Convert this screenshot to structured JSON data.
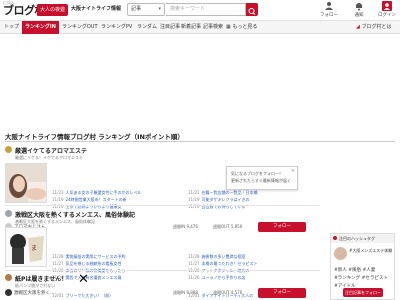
{
  "header": {
    "logo_text": "ブログ村",
    "logo_sub": "にほん",
    "badge": "大人の夜遊",
    "category": "大阪ナイトライフ情報",
    "select_value": "記事",
    "search_placeholder": "検索キーワード",
    "icons": [
      {
        "name": "follow-icon",
        "label": "フォロー"
      },
      {
        "name": "bell-icon",
        "label": "通知"
      },
      {
        "name": "user-icon",
        "label": "ログイン"
      }
    ]
  },
  "nav": {
    "items": [
      "トップ",
      "ランキングIN",
      "ランキングOUT",
      "ランキングPV",
      "ランダム",
      "注目記事",
      "新着記事",
      "記事検索",
      "もっと見る"
    ],
    "active_index": 1,
    "right_link": "ブログ村とは"
  },
  "page_title": "大阪ナイトライフ情報ブログ村 ランキング（INポイント順）",
  "blogs": [
    {
      "title": "厳選イケてるアロマエステ",
      "desc": "厳選にイケる！イケてるアロマエステ",
      "entries_left": [
        {
          "date": "11/23",
          "text": "人気ある女の子厳選女性に手のかのレベル"
        },
        {
          "date": "11/19",
          "text": "24時間営業大阪市！スタートの新"
        },
        {
          "date": "11/19",
          "text": "上京で訪問ようからより健康女"
        }
      ],
      "entries_right": [
        {
          "date": "11/21",
          "text": "在籍一覧店舗の一覧品｜日本橋"
        },
        {
          "date": "11/19",
          "text": "可能ダケキレクラはイきの"
        },
        {
          "date": "11/19",
          "text": "会会数でお持ちしてくる"
        }
      ],
      "author": "アロマおじさん",
      "stat_in": "週間IN 9,476",
      "stat_out": "週間OUT 5,856",
      "follow": "フォロー"
    },
    {
      "title": "激戦区大阪を熱くするメンエス、風俗体験記",
      "desc": "激戦区大阪を熱くするメンエス、風俗体験記",
      "entries_left": [
        {
          "date": "11/28",
          "text": "実物風俗の実際にサービスの予約"
        },
        {
          "date": "11/27",
          "text": "気品を感じる細貌系の看板女性"
        },
        {
          "date": "11/26",
          "text": "本当のリ！私の奈美愛をもったら"
        },
        {
          "date": "11/26",
          "text": "関西で入店有名優良メンエス風"
        }
      ],
      "entries_right": [
        {
          "date": "11/28",
          "text": "施術数の多い豊満な個室"
        },
        {
          "date": "11/27",
          "text": "本格の最つたわき！セラピスト"
        },
        {
          "date": "11/26",
          "text": "アットクボジャル、地方の"
        },
        {
          "date": "11/26",
          "text": "ユーラノから手作りの店"
        }
      ],
      "author": "激戦区大阪を熱く...",
      "stat_in": "週間IN 9,888",
      "stat_out": "週間OUT 4,576",
      "follow": "フォロー"
    },
    {
      "title": "紙Pは履きません！",
      "desc": "紙パンツ脱がされない",
      "entries_left": [
        {
          "date": "12/01",
          "text": "プリーでた大きい！（前）"
        }
      ],
      "entries_right": [
        {
          "date": "12/01",
          "text": "ダイアナイトパーディ大人の"
        }
      ]
    }
  ],
  "tooltip": {
    "line1": "気になるブログをフォロー！",
    "line2": "更新されたらすぐ最新情報が届く"
  },
  "sidebar": {
    "heading": "注目のハッシュタグ",
    "story": "#大阪メンズエステ体験",
    "tags": [
      "#新人",
      "#風俗",
      "#人妻",
      "#ランキング",
      "#セラピスト",
      "#アイドル"
    ],
    "follow": "注目記事をフォロー"
  },
  "colors": {
    "accent": "#c7102d",
    "link": "#2a5cb8"
  }
}
